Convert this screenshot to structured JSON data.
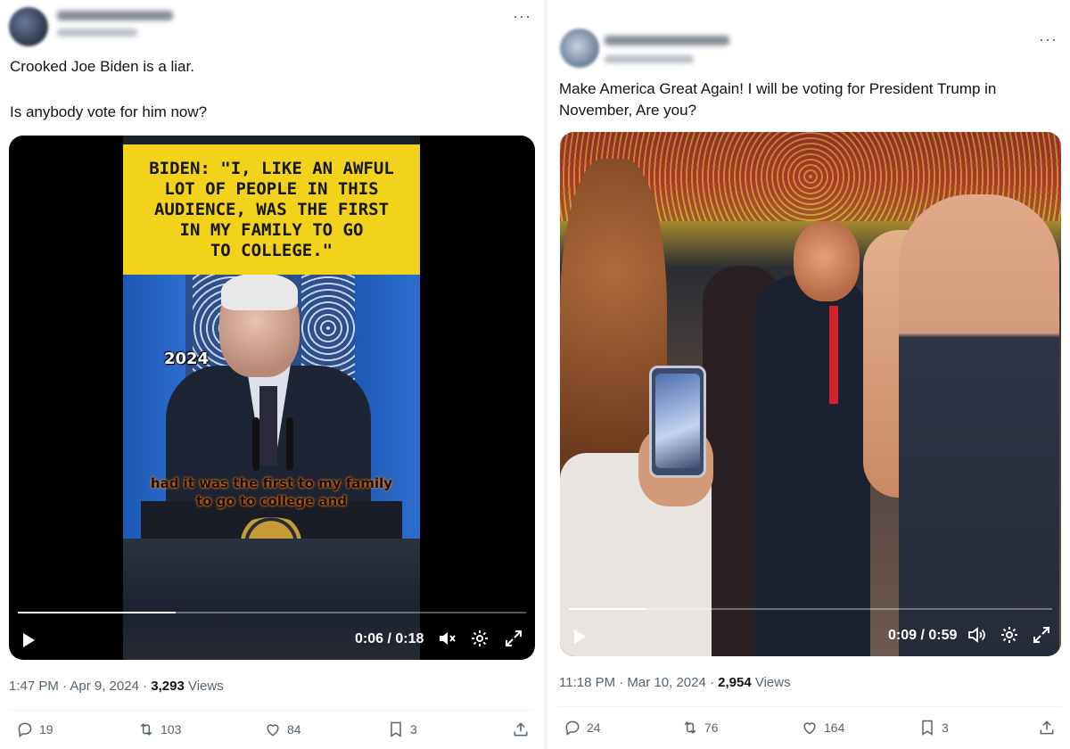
{
  "left_post": {
    "text_line1": "Crooked Joe Biden is a liar.",
    "text_line2": "Is anybody vote for him now?",
    "video": {
      "caption": "BIDEN: \"I, LIKE AN AWFUL\nLOT OF PEOPLE IN THIS\nAUDIENCE, WAS THE FIRST\nIN MY FAMILY TO GO\nTO COLLEGE.\"",
      "overlay_year": "2024",
      "subtitle_line1": "had it was the first to my family",
      "subtitle_line2": "to go to college and",
      "time": "0:06 / 0:18",
      "progress": 0.31
    },
    "timestamp": "1:47 PM · Apr 9, 2024 · ",
    "views_count": "3,293",
    "views_label": " Views",
    "replies": "19",
    "reposts": "103",
    "likes": "84",
    "bookmarks": "3"
  },
  "right_post": {
    "text_line1": "Make America Great Again! I will be voting for President Trump in",
    "text_line2": "November, Are you?",
    "video": {
      "time": "0:09 / 0:59",
      "progress": 0.16
    },
    "timestamp": "11:18 PM · Mar 10, 2024 · ",
    "views_count": "2,954",
    "views_label": " Views",
    "replies": "24",
    "reposts": "76",
    "likes": "164",
    "bookmarks": "3"
  },
  "icons": {
    "more": "more-icon",
    "play": "play-icon",
    "mute": "volume-muted-icon",
    "volume": "volume-icon",
    "settings": "gear-icon",
    "fullscreen": "fullscreen-icon",
    "reply": "reply-icon",
    "repost": "repost-icon",
    "like": "heart-icon",
    "bookmark": "bookmark-icon",
    "share": "share-icon"
  },
  "colors": {
    "text": "#0f1419",
    "muted": "#536471",
    "caption_bg": "#f3d21c"
  }
}
